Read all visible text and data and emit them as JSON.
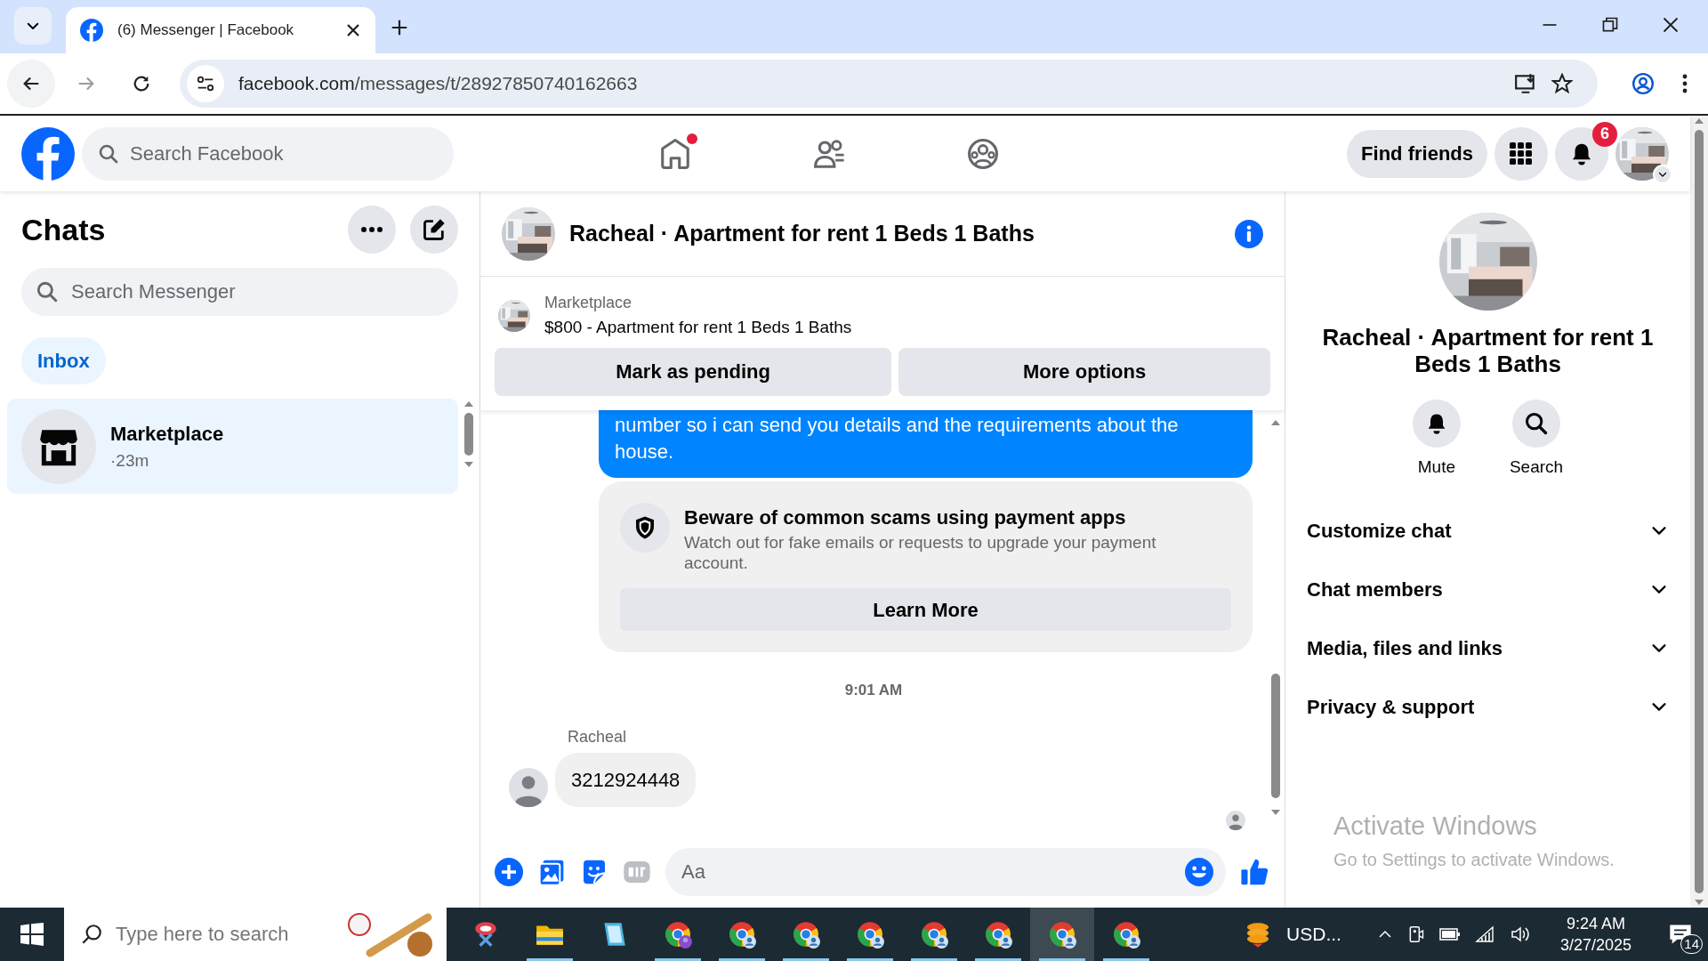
{
  "browser": {
    "tab_title": "(6) Messenger | Facebook",
    "url_domain": "facebook.com",
    "url_path": "/messages/t/28927850740162663"
  },
  "header": {
    "search_placeholder": "Search Facebook",
    "nav": [
      {
        "kind": "home",
        "notification": true
      },
      {
        "kind": "friends",
        "notification": false
      },
      {
        "kind": "groups",
        "notification": false
      }
    ],
    "find_friends": "Find friends",
    "notification_count": "6"
  },
  "chats": {
    "title": "Chats",
    "search_placeholder": "Search Messenger",
    "filters": [
      {
        "label": "Inbox",
        "selected": true
      }
    ],
    "items": [
      {
        "name": "Marketplace",
        "time": "·23m",
        "selected": true
      }
    ]
  },
  "conversation": {
    "title": "Racheal · Apartment for rent 1 Beds 1 Baths",
    "listing": {
      "source": "Marketplace",
      "title": "$800 - Apartment for rent 1 Beds 1 Baths"
    },
    "actions": [
      "Mark as pending",
      "More options"
    ],
    "messages": [
      {
        "kind": "outgoing",
        "text": "number so i can send you details and the requirements about the house."
      },
      {
        "kind": "notice",
        "title": "Beware of common scams using payment apps",
        "text": "Watch out for fake emails or requests to upgrade your payment account.",
        "button": "Learn More"
      },
      {
        "kind": "timestamp",
        "text": "9:01 AM"
      },
      {
        "kind": "incoming",
        "sender": "Racheal",
        "text": "3212924448"
      }
    ],
    "composer_placeholder": "Aa"
  },
  "details": {
    "title": "Racheal · Apartment for rent 1 Beds 1 Baths",
    "actions": [
      {
        "kind": "mute",
        "label": "Mute"
      },
      {
        "kind": "search",
        "label": "Search"
      }
    ],
    "sections": [
      {
        "label": "Customize chat",
        "expanded": false
      },
      {
        "label": "Chat members",
        "expanded": false
      },
      {
        "label": "Media, files and links",
        "expanded": false
      },
      {
        "label": "Privacy & support",
        "expanded": false
      }
    ]
  },
  "activation_notice": {
    "title": "Activate Windows",
    "text": "Go to Settings to activate Windows."
  },
  "taskbar": {
    "search_placeholder": "Type here to search",
    "apps": [
      {
        "kind": "tool",
        "selected": false,
        "running": false
      },
      {
        "kind": "folder",
        "selected": false,
        "running": true
      },
      {
        "kind": "notepad",
        "selected": false,
        "running": false
      },
      {
        "kind": "browser-purple",
        "selected": false,
        "running": true
      },
      {
        "kind": "browser",
        "selected": false,
        "running": true
      },
      {
        "kind": "browser",
        "selected": false,
        "running": true
      },
      {
        "kind": "browser",
        "selected": false,
        "running": true
      },
      {
        "kind": "browser",
        "selected": false,
        "running": true
      },
      {
        "kind": "browser",
        "selected": false,
        "running": true
      },
      {
        "kind": "browser",
        "selected": true,
        "running": true
      },
      {
        "kind": "browser",
        "selected": false,
        "running": true
      }
    ],
    "tray_label": "USD...",
    "time": "9:24 AM",
    "date": "3/27/2025",
    "notification_count": "14"
  }
}
